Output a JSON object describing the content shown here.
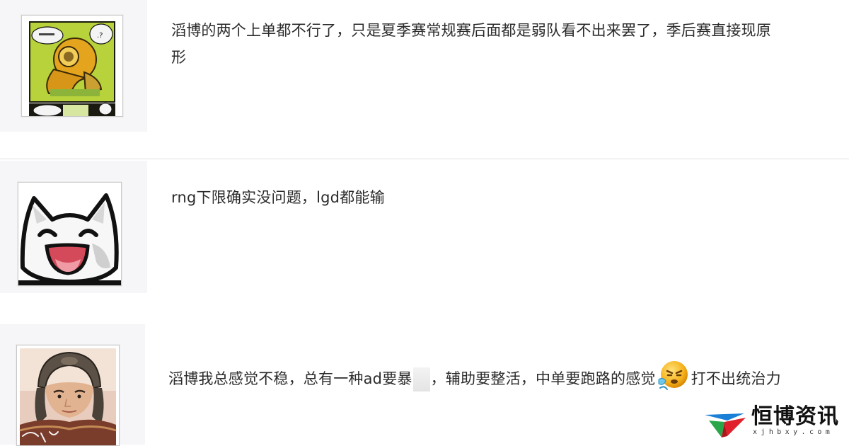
{
  "comments": [
    {
      "avatar": "comic-diver-avatar",
      "text_line1": "滔博的两个上单都不行了，只是夏季赛常规赛后面都是弱队看不出来罢了，季后赛直接现原",
      "text_line2": "形"
    },
    {
      "avatar": "white-cat-avatar",
      "text_line1": "rng下限确实没问题，lgd都能输"
    },
    {
      "avatar": "warrior-helmet-avatar",
      "text_part1": "滔博我总感觉不稳，总有一种ad要暴",
      "text_part2": "，辅助要整活，中单要跑路的感觉",
      "emoji": "sneeze-emoji",
      "text_part3": "打不出统治力"
    }
  ],
  "watermark": {
    "title": "恒博资讯",
    "domain": "xjhbxy.com",
    "colors": {
      "blue": "#1a7fd6",
      "red": "#e0202a",
      "green": "#2aa64a"
    }
  }
}
